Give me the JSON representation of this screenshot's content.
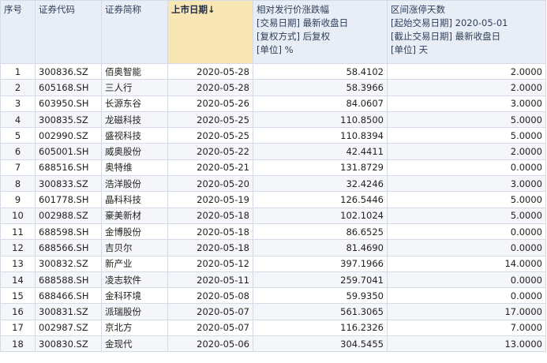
{
  "headers": {
    "index": "序号",
    "code": "证券代码",
    "name": "证券简称",
    "list_date": "上市日期↓",
    "change": [
      "相对发行价涨跌幅",
      "[交易日期] 最新收盘日",
      "[复权方式] 后复权",
      "[单位] %"
    ],
    "limit_days": [
      "区间涨停天数",
      "[起始交易日期] 2020-05-01",
      "[截止交易日期] 最新收盘日",
      "[单位] 天"
    ]
  },
  "rows": [
    {
      "idx": "1",
      "code": "300836.SZ",
      "name": "佰奥智能",
      "date": "2020-05-28",
      "change": "58.4102",
      "days": "2.0000"
    },
    {
      "idx": "2",
      "code": "605168.SH",
      "name": "三人行",
      "date": "2020-05-28",
      "change": "58.3966",
      "days": "2.0000"
    },
    {
      "idx": "3",
      "code": "603950.SH",
      "name": "长源东谷",
      "date": "2020-05-26",
      "change": "84.0607",
      "days": "3.0000"
    },
    {
      "idx": "4",
      "code": "300835.SZ",
      "name": "龙磁科技",
      "date": "2020-05-25",
      "change": "110.8500",
      "days": "5.0000"
    },
    {
      "idx": "5",
      "code": "002990.SZ",
      "name": "盛视科技",
      "date": "2020-05-25",
      "change": "110.8394",
      "days": "5.0000"
    },
    {
      "idx": "6",
      "code": "605001.SH",
      "name": "威奥股份",
      "date": "2020-05-22",
      "change": "42.4411",
      "days": "2.0000"
    },
    {
      "idx": "7",
      "code": "688516.SH",
      "name": "奥特维",
      "date": "2020-05-21",
      "change": "131.8729",
      "days": "0.0000"
    },
    {
      "idx": "8",
      "code": "300833.SZ",
      "name": "浩洋股份",
      "date": "2020-05-20",
      "change": "32.4246",
      "days": "3.0000"
    },
    {
      "idx": "9",
      "code": "601778.SH",
      "name": "晶科科技",
      "date": "2020-05-19",
      "change": "126.5446",
      "days": "5.0000"
    },
    {
      "idx": "10",
      "code": "002988.SZ",
      "name": "豪美新材",
      "date": "2020-05-18",
      "change": "102.1024",
      "days": "5.0000"
    },
    {
      "idx": "11",
      "code": "688598.SH",
      "name": "金博股份",
      "date": "2020-05-18",
      "change": "86.6525",
      "days": "0.0000"
    },
    {
      "idx": "12",
      "code": "688566.SH",
      "name": "吉贝尔",
      "date": "2020-05-18",
      "change": "81.4690",
      "days": "0.0000"
    },
    {
      "idx": "13",
      "code": "300832.SZ",
      "name": "新产业",
      "date": "2020-05-12",
      "change": "397.1966",
      "days": "14.0000"
    },
    {
      "idx": "14",
      "code": "688588.SH",
      "name": "凌志软件",
      "date": "2020-05-11",
      "change": "259.7041",
      "days": "0.0000"
    },
    {
      "idx": "15",
      "code": "688466.SH",
      "name": "金科环境",
      "date": "2020-05-08",
      "change": "59.9350",
      "days": "0.0000"
    },
    {
      "idx": "16",
      "code": "300831.SZ",
      "name": "派瑞股份",
      "date": "2020-05-07",
      "change": "561.3065",
      "days": "17.0000"
    },
    {
      "idx": "17",
      "code": "002987.SZ",
      "name": "京北方",
      "date": "2020-05-07",
      "change": "116.2326",
      "days": "7.0000"
    },
    {
      "idx": "18",
      "code": "300830.SZ",
      "name": "金现代",
      "date": "2020-05-06",
      "change": "304.5455",
      "days": "13.0000"
    }
  ]
}
